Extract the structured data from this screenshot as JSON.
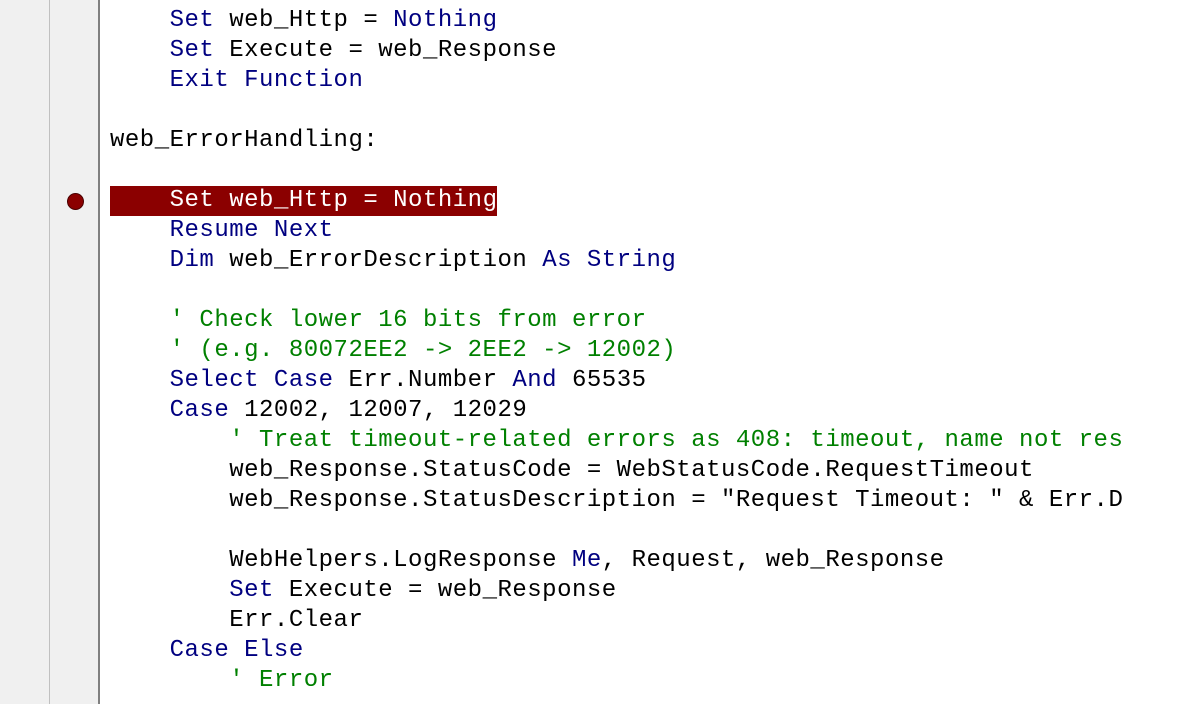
{
  "code": {
    "line1_indent": "    ",
    "line1_kw1": "Set",
    "line1_ident": " web_Http = ",
    "line1_kw2": "Nothing",
    "line2_indent": "    ",
    "line2_kw1": "Set",
    "line2_ident": " Execute = web_Response",
    "line3_indent": "    ",
    "line3_kw": "Exit Function",
    "line4": "",
    "line5": "web_ErrorHandling:",
    "line6": "",
    "line7_indent": "    ",
    "line7_kw1": "Set",
    "line7_ident": " web_Http = ",
    "line7_kw2": "Nothing",
    "line8_indent": "    ",
    "line8_kw": "Resume Next",
    "line9_indent": "    ",
    "line9_kw1": "Dim",
    "line9_ident": " web_ErrorDescription ",
    "line9_kw2": "As String",
    "line10": "",
    "line11_indent": "    ",
    "line11_comment": "' Check lower 16 bits from error",
    "line12_indent": "    ",
    "line12_comment": "' (e.g. 80072EE2 -> 2EE2 -> 12002)",
    "line13_indent": "    ",
    "line13_kw1": "Select Case",
    "line13_ident1": " Err.Number ",
    "line13_kw2": "And",
    "line13_ident2": " 65535",
    "line14_indent": "    ",
    "line14_kw": "Case",
    "line14_ident": " 12002, 12007, 12029",
    "line15_indent": "        ",
    "line15_comment": "' Treat timeout-related errors as 408: timeout, name not res",
    "line16_indent": "        ",
    "line16_ident": "web_Response.StatusCode = WebStatusCode.RequestTimeout",
    "line17_indent": "        ",
    "line17_ident": "web_Response.StatusDescription = \"Request Timeout: \" & Err.D",
    "line18": "",
    "line19_indent": "        ",
    "line19_ident": "WebHelpers.LogResponse ",
    "line19_kw": "Me",
    "line19_ident2": ", Request, web_Response",
    "line20_indent": "        ",
    "line20_kw": "Set",
    "line20_ident": " Execute = web_Response",
    "line21_indent": "        ",
    "line21_ident": "Err.Clear",
    "line22_indent": "    ",
    "line22_kw": "Case Else",
    "line23_indent": "        ",
    "line23_comment": "' Error"
  },
  "breakpoint_top": "193"
}
